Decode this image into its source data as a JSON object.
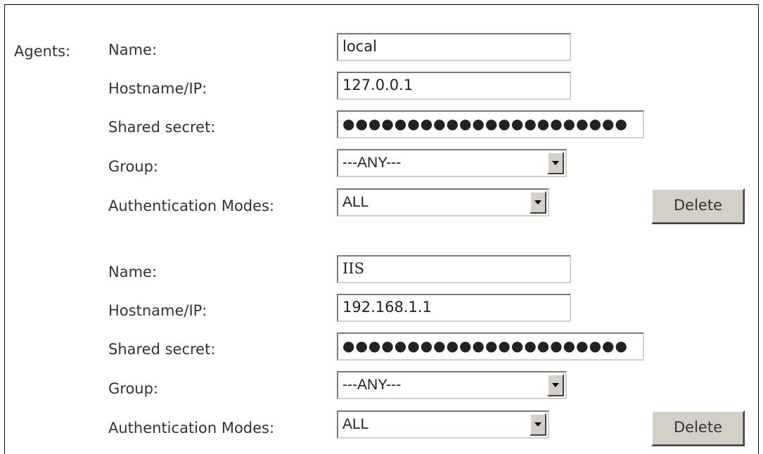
{
  "section_label": "Agents:",
  "labels": {
    "name": "Name:",
    "hostname": "Hostname/IP:",
    "secret": "Shared secret:",
    "group": "Group:",
    "auth_modes": "Authentication Modes:"
  },
  "agents": [
    {
      "name": "local",
      "hostname": "127.0.0.1",
      "secret_masked": "●●●●●●●●●●●●●●●●●●●●●●",
      "group": "---ANY---",
      "auth_modes": "ALL",
      "delete_label": "Delete"
    },
    {
      "name": "IIS",
      "hostname": "192.168.1.1",
      "secret_masked": "●●●●●●●●●●●●●●●●●●●●●●",
      "group": "---ANY---",
      "auth_modes": "ALL",
      "delete_label": "Delete"
    }
  ],
  "icons": {
    "dropdown": "chevron-down-icon"
  }
}
